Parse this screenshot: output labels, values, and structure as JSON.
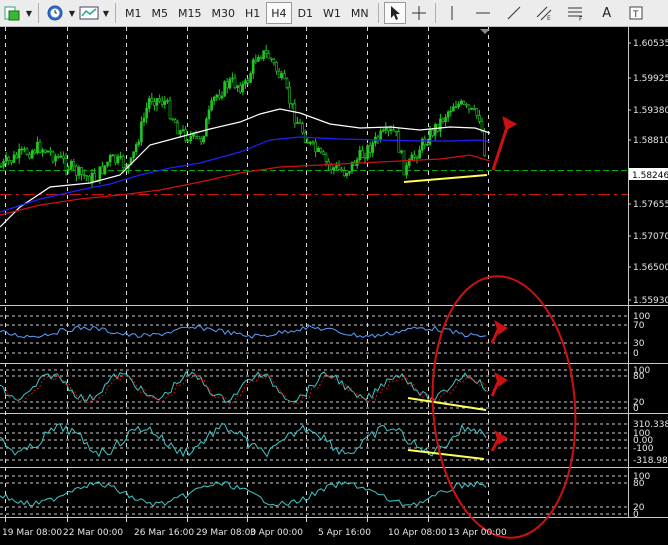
{
  "toolbar": {
    "timeframes": [
      "M1",
      "M5",
      "M15",
      "M30",
      "H1",
      "H4",
      "D1",
      "W1",
      "MN"
    ],
    "active_timeframe": "H4",
    "text_tool": "A"
  },
  "price_axis": {
    "labels": [
      "1.60535",
      "1.59925",
      "1.59380",
      "1.58810",
      "1.58246",
      "1.57655",
      "1.57070",
      "1.56500",
      "1.55930"
    ],
    "current_price": "1.58246"
  },
  "indicator1": {
    "levels": [
      "100",
      "70",
      "30",
      "0"
    ]
  },
  "indicator2": {
    "levels": [
      "100",
      "80",
      "20",
      "0"
    ]
  },
  "indicator3": {
    "levels": [
      "310.338",
      "100",
      "0.00",
      "-100",
      "-318.980"
    ]
  },
  "indicator4": {
    "levels": [
      "100",
      "80",
      "20",
      "0"
    ]
  },
  "time_axis": {
    "labels": [
      "19 Mar 08:00",
      "22 Mar 00:00",
      "26 Mar 16:00",
      "29 Mar 08:00",
      "3 Apr 00:00",
      "5 Apr 16:00",
      "10 Apr 08:00",
      "13 Apr 00:00"
    ]
  },
  "colors": {
    "candle": "#22c522",
    "ma_white": "#ffffff",
    "ma_blue": "#2020ff",
    "ma_red": "#d01010",
    "annotation_yellow": "#ffff55",
    "annotation_red": "#cc1111",
    "osc_line": "#5aa0ff",
    "osc_line2": "#3fc7c7",
    "grid": "#ffffff"
  }
}
